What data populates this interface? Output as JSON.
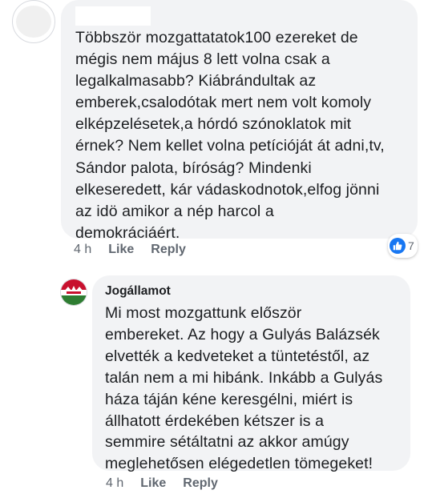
{
  "comment1": {
    "author_redacted": true,
    "lines": [
      "Többször mozgattatatok100 ezereket de",
      "mégis nem május 8 lett volna csak a",
      "legalkalmasabb? Kiábrándultak az",
      "emberek,csalodótak mert nem volt komoly",
      "elképzelésetek,a hórdó szónoklatok mit",
      "érnek? Nem kellet volna petícióját át adni,tv,",
      "Sándor palota, bíróság? Mindenki",
      "elkeseredett, kár vádaskodnotok,elfog jönni",
      "az idö amikor a nép  harcol a",
      "demokráciáért."
    ],
    "time": "4 h",
    "like_label": "Like",
    "reply_label": "Reply",
    "reaction_count": "7",
    "reaction_icon": "like-icon",
    "reaction_color": "#1877f2"
  },
  "comment2": {
    "author": "Jogállamot",
    "lines": [
      "Mi most mozgattunk először",
      "embereket. Az hogy a Gulyás Balázsék",
      "elvették a kedveteket a tüntetéstől, az",
      "talán nem a mi hibánk. Inkább a Gulyás",
      "háza táján kéne keresgélni, miért is",
      "állhatott érdekében kétszer is a",
      "semmire sétáltatni az akkor amúgy",
      "meglehetősen elégedetlen tömegeket!"
    ],
    "time": "4 h",
    "like_label": "Like",
    "reply_label": "Reply",
    "avatar_icon": "red-white-green-logo-icon"
  },
  "colors": {
    "bubble": "#f2f3f5",
    "meta_text": "#606770",
    "body_text": "#1c1e21",
    "avatar_red": "#c8102e",
    "avatar_green": "#2e7d32"
  }
}
